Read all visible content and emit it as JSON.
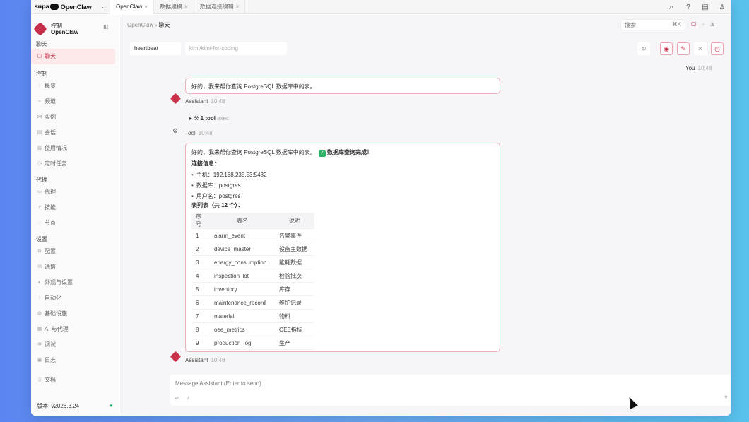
{
  "brand": {
    "logo": "supa",
    "name": "OpenClaw",
    "more": "···"
  },
  "tabs": [
    {
      "label": "OpenClaw",
      "active": true
    },
    {
      "label": "数据建模",
      "active": false
    },
    {
      "label": "数据连接编辑",
      "active": false
    }
  ],
  "topbar_icons": [
    "search-icon",
    "help-icon",
    "clipboard-icon",
    "user-icon"
  ],
  "sidebar": {
    "title_line1": "控制",
    "title_line2": "OpenClaw",
    "sections": {
      "chat": {
        "label": "聊天",
        "items": [
          {
            "label": "聊天",
            "active": true
          }
        ]
      },
      "control": {
        "label": "控制",
        "items": [
          {
            "label": "概览"
          },
          {
            "label": "频道"
          },
          {
            "label": "实例"
          },
          {
            "label": "会话"
          },
          {
            "label": "使用情况"
          },
          {
            "label": "定时任务"
          }
        ]
      },
      "agent": {
        "label": "代理",
        "items": [
          {
            "label": "代理"
          },
          {
            "label": "技能"
          },
          {
            "label": "节点"
          }
        ]
      },
      "settings": {
        "label": "设置",
        "items": [
          {
            "label": "配置"
          },
          {
            "label": "通信"
          },
          {
            "label": "外观与设置"
          },
          {
            "label": "自动化"
          },
          {
            "label": "基础设施"
          },
          {
            "label": "AI 与代理"
          },
          {
            "label": "调试"
          },
          {
            "label": "日志"
          }
        ]
      },
      "docs": {
        "label": "文档"
      }
    },
    "version_label": "版本",
    "version": "v2026.3.24"
  },
  "header": {
    "breadcrumb_root": "OpenClaw",
    "breadcrumb_sep": "›",
    "breadcrumb_current": "聊天",
    "search_placeholder": "搜索",
    "search_shortcut": "⌘K"
  },
  "session": {
    "name": "heartbeat",
    "model": "kimi/kimi-for-coding"
  },
  "messages": {
    "user": {
      "name": "You",
      "time": "10:48"
    },
    "assistant1": {
      "text": "好的，我来帮你查询 PostgreSQL 数据库中的表。",
      "name": "Assistant",
      "time": "10:48"
    },
    "tool_summary": {
      "prefix": "▸ ⚒",
      "count": "1 tool",
      "sub": "exec"
    },
    "tool": {
      "name": "Tool",
      "time": "10:48"
    },
    "assistant2": {
      "intro": "好的，我来帮你查询 PostgreSQL 数据库中的表。",
      "done": "数据库查询完成！",
      "conn_title": "连接信息：",
      "conn": [
        "主机：192.168.235.53:5432",
        "数据库：postgres",
        "用户名：postgres"
      ],
      "table_title": "表列表（共 12 个）：",
      "columns": {
        "no": "序号",
        "name": "表名",
        "desc": "说明"
      },
      "rows": [
        {
          "no": "1",
          "name": "alarm_event",
          "desc": "告警事件"
        },
        {
          "no": "2",
          "name": "device_master",
          "desc": "设备主数据"
        },
        {
          "no": "3",
          "name": "energy_consumption",
          "desc": "能耗数据"
        },
        {
          "no": "4",
          "name": "inspection_lot",
          "desc": "检验批次"
        },
        {
          "no": "5",
          "name": "inventory",
          "desc": "库存"
        },
        {
          "no": "6",
          "name": "maintenance_record",
          "desc": "维护记录"
        },
        {
          "no": "7",
          "name": "material",
          "desc": "物料"
        },
        {
          "no": "8",
          "name": "oee_metrics",
          "desc": "OEE指标"
        },
        {
          "no": "9",
          "name": "production_log",
          "desc": "生产"
        }
      ]
    },
    "assistant3": {
      "name": "Assistant",
      "time": "10:48"
    }
  },
  "composer": {
    "placeholder": "Message Assistant (Enter to send)"
  },
  "colors": {
    "accent": "#c9304a",
    "bubble_border": "#eab2bc",
    "success": "#2bb36a"
  }
}
